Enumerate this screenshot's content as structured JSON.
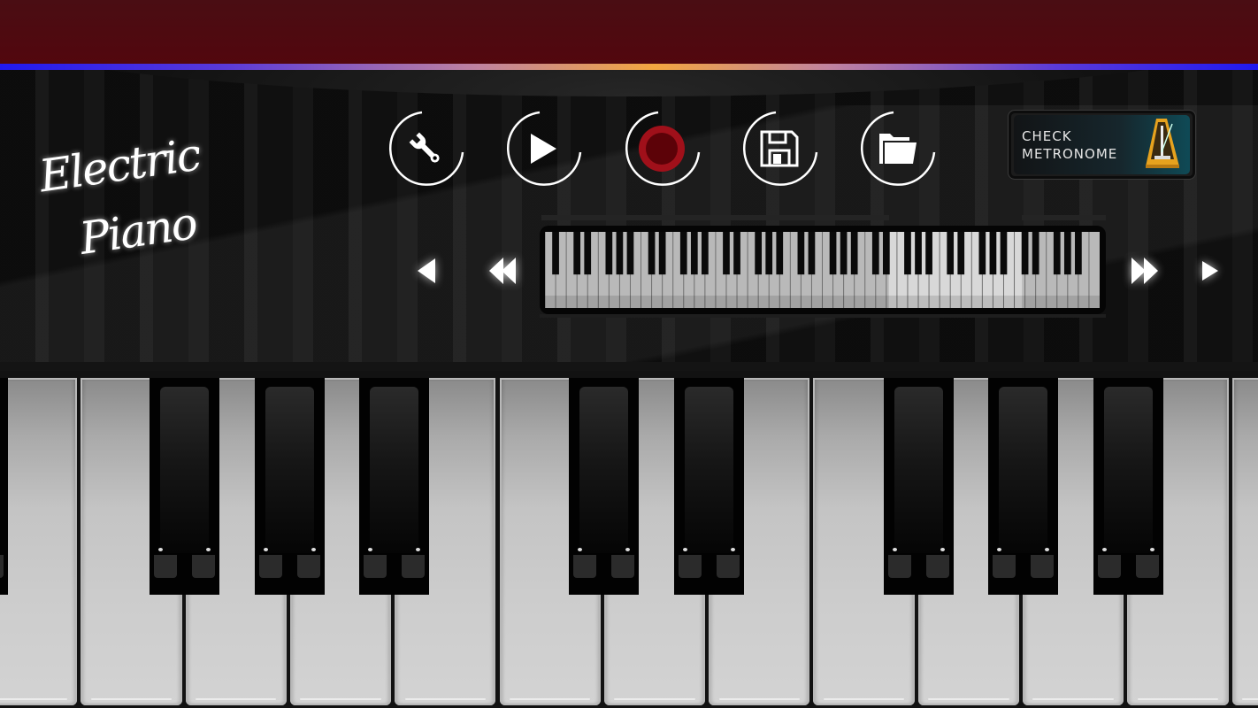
{
  "app": {
    "title_line1": "Electric",
    "title_line2": "Piano"
  },
  "colors": {
    "top_band": "#4e0a11",
    "accent_left": "#2019f0",
    "accent_center": "#f3a640",
    "record_red": "#a0101a",
    "metronome_teal": "#0f4a56",
    "metronome_gold": "#e6a21e"
  },
  "toolbar": {
    "buttons": [
      {
        "name": "settings",
        "icon": "wrench-icon"
      },
      {
        "name": "play",
        "icon": "play-icon"
      },
      {
        "name": "record",
        "icon": "record-icon"
      },
      {
        "name": "save",
        "icon": "floppy-disk-icon"
      },
      {
        "name": "open",
        "icon": "folder-icon"
      }
    ]
  },
  "metronome_button": {
    "line1": "CHECK",
    "line2": "METRONOME",
    "icon": "metronome-icon"
  },
  "navigation": {
    "buttons": [
      {
        "name": "previous-key",
        "icon": "triangle-left-icon"
      },
      {
        "name": "previous-octave",
        "icon": "double-triangle-left-icon"
      },
      {
        "name": "next-octave",
        "icon": "double-triangle-right-icon"
      },
      {
        "name": "next-key",
        "icon": "triangle-right-icon"
      }
    ]
  },
  "mini_keyboard": {
    "total_keys": 88,
    "white_keys": 52,
    "first_note": "A0",
    "visible_range_start_fraction": 0.62,
    "visible_range_end_fraction": 0.86
  },
  "main_keyboard": {
    "visible_white_keys": 13,
    "visible_black_keys": 9,
    "pattern": "partial-black, W, W, B, W, B, W, B, W, W, B, W, B, W, W, B, W, B, W, B, W, W"
  }
}
